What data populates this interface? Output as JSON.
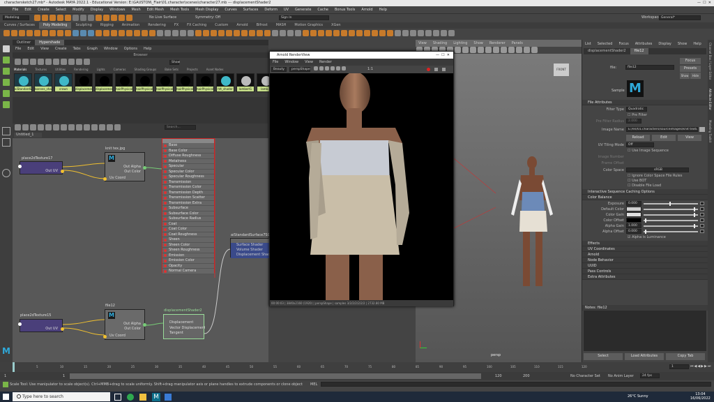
{
  "title_bar": {
    "text": "charactersketch27.mb* - Autodesk MAYA 2022.1 - Educational Version: E:\\GAUSTON\\_Flair\\01.character\\scenes\\character27.mb  ---  displacementShader2"
  },
  "menu": [
    "File",
    "Edit",
    "Create",
    "Select",
    "Modify",
    "Display",
    "Windows",
    "Mesh",
    "Edit Mesh",
    "Mesh Tools",
    "Mesh Display",
    "Curves",
    "Surfaces",
    "Deform",
    "UV",
    "Generate",
    "Cache",
    "Bonus Tools",
    "Arnold",
    "Help"
  ],
  "status_line": {
    "mode": "Modeling",
    "live": "No Live Surface",
    "symmetry": "Symmetry: Off",
    "signin": "Sign In",
    "workspace_label": "Workspace:",
    "workspace": "General*"
  },
  "shelf_tabs": [
    "Curves / Surfaces",
    "Poly Modeling",
    "Sculpting",
    "Rigging",
    "Animation",
    "Rendering",
    "FX",
    "FX Caching",
    "Custom",
    "Arnold",
    "Bifrost",
    "MASH",
    "Motion Graphics",
    "XGen"
  ],
  "hypershade": {
    "tabs": [
      "Outliner",
      "Hypershade"
    ],
    "menu": [
      "File",
      "Edit",
      "View",
      "Create",
      "Tabs",
      "Graph",
      "Window",
      "Options",
      "Help"
    ],
    "browser_label": "Browser",
    "subtabs": [
      "Materials",
      "Textures",
      "Utilities",
      "Rendering",
      "Lights",
      "Cameras",
      "Shading Groups",
      "Bake Sets",
      "Projects",
      "Asset Nodes"
    ],
    "show": "Show",
    "swatches": [
      "aiStandardS...",
      "bonnes_shader",
      "crown",
      "displacement",
      "displacement...",
      "hairPhysical...",
      "hairPhysical...",
      "hairPhysical...",
      "hairPhysical...",
      "hairPhysical...",
      "htt_shader",
      "lambert1",
      "lamb..."
    ],
    "graph_tab": "Untitled_1",
    "search_placeholder": "Search..."
  },
  "nodes": {
    "place1": {
      "title": "place2dTexture17",
      "out": "Out UV"
    },
    "knit": {
      "title": "knit tex.jpg",
      "out_alpha": "Out Alpha",
      "out_color": "Out Color",
      "uv": "Uv Coord"
    },
    "shader_attrs": [
      "Base",
      "Base Color",
      "Diffuse Roughness",
      "Metalness",
      "Specular",
      "Specular Color",
      "Specular Roughness",
      "Transmission",
      "Transmission Color",
      "Transmission Depth",
      "Transmission Scatter",
      "Transmission Extra Roughness",
      "Subsurface",
      "Subsurface Color",
      "Subsurface Radius",
      "Coat",
      "Coat Color",
      "Coat Roughness",
      "Sheen",
      "Sheen Color",
      "Sheen Roughness",
      "Emission",
      "Emission Color",
      "Opacity",
      "Normal Camera"
    ],
    "sg": {
      "title": "aiStandardSurface7SG",
      "rows": [
        "Surface Shader",
        "Volume Shader",
        "Displacement Shader"
      ]
    },
    "place2": {
      "title": "place2dTexture15",
      "out": "Out UV"
    },
    "file": {
      "title": "file12",
      "out_alpha": "Out Alpha",
      "out_color": "Out Color",
      "uv": "Uv Coord"
    },
    "disp": {
      "title": "displacementShader2",
      "rows": [
        "Displacement",
        "Vector Displacement",
        "Tangent"
      ]
    }
  },
  "render_view": {
    "title": "Arnold RenderView",
    "menu": [
      "File",
      "Window",
      "View",
      "Render"
    ],
    "camera": "Beauty",
    "cam2": "perspShape",
    "zoom": "1:1",
    "status": "00:00:03 | 3840x2160 (1920) | perspShape | samples 3/2/2/2/2/2/2 | 2732.80 MB"
  },
  "viewport": {
    "menu": [
      "View",
      "Shading",
      "Lighting",
      "Show",
      "Renderer",
      "Panels"
    ],
    "label": "persp",
    "cube": "FRONT"
  },
  "attr_editor": {
    "menu": [
      "List",
      "Selected",
      "Focus",
      "Attributes",
      "Display",
      "Show",
      "Help"
    ],
    "tabs": [
      "displacementShader2",
      "file12"
    ],
    "file_label": "file:",
    "file_value": "file12",
    "focus": "Focus",
    "presets": "Presets",
    "show": "Show",
    "hide": "Hide",
    "sample": "Sample",
    "sections": {
      "file_attrs": "File Attributes",
      "interactive": "Interactive Sequence Caching Options",
      "color_balance": "Color Balance",
      "closed": [
        "Effects",
        "UV Coordinates",
        "Arnold",
        "Node Behavior",
        "UUID",
        "Extra Attributes"
      ],
      "pass": "Pass Controls"
    },
    "filter_type_label": "Filter Type",
    "filter_type": "Quadratic",
    "pre_filter": "Pre Filter",
    "pre_filter_radius": "Pre Filter Radius",
    "pre_filter_radius_val": "2.000",
    "image_name_label": "Image Name",
    "image_name": "E:/en/01.characters/sourceimages/knit texture bump.png",
    "reload": "Reload",
    "edit": "Edit",
    "view": "View",
    "uv_tiling_label": "UV Tiling Mode",
    "uv_tiling": "Off",
    "use_seq": "Use Image Sequence",
    "image_number": "Image Number",
    "frame_offset": "Frame Offset",
    "color_space_label": "Color Space",
    "color_space": "sRGB",
    "ignore_cs": "Ignore Color Space File Rules",
    "use_bot": "Use BOT",
    "disable_load": "Disable File Load",
    "cb_rows": [
      {
        "label": "Exposure",
        "value": "0.000"
      },
      {
        "label": "Default Color",
        "value": ""
      },
      {
        "label": "Color Gain",
        "value": ""
      },
      {
        "label": "Color Offset",
        "value": ""
      },
      {
        "label": "Alpha Gain",
        "value": "1.000"
      },
      {
        "label": "Alpha Offset",
        "value": "0.000"
      }
    ],
    "alpha_lum": "Alpha is Luminance",
    "notes_label": "Notes: file12",
    "select": "Select",
    "load_attrs": "Load Attributes",
    "copy_tab": "Copy Tab"
  },
  "side_tabs": [
    "Channel Box / Layer Editor",
    "Attribute Editor",
    "Modeling Toolkit"
  ],
  "timeline": {
    "start": "1",
    "end": "120",
    "ticks": [
      "5",
      "10",
      "15",
      "20",
      "25",
      "30",
      "35",
      "40",
      "45",
      "50",
      "55",
      "60",
      "65",
      "70",
      "75",
      "80",
      "85",
      "90",
      "95",
      "100",
      "105",
      "110",
      "115",
      "120"
    ],
    "range_start": "1",
    "range_in": "1",
    "range_out": "120",
    "range_end": "200",
    "char_set": "No Character Set",
    "anim_layer": "No Anim Layer",
    "fps": "24 fps",
    "current": "1"
  },
  "help_line": {
    "text": "Scale Tool: Use manipulator to scale object(s). Ctrl+MMB+drag to scale uniformly. Shift+drag manipulator axis or plane handles to extrude components or clone objects. Ctrl+Shift+LMB+drag to constrain scaling to connected edges. Use D or INSERT to change the pivot position and axis orientation.",
    "mel": "MEL"
  },
  "taskbar": {
    "search": "Type here to search",
    "weather": "26°C  Sunny",
    "time": "13:04",
    "date": "16/06/2022"
  }
}
